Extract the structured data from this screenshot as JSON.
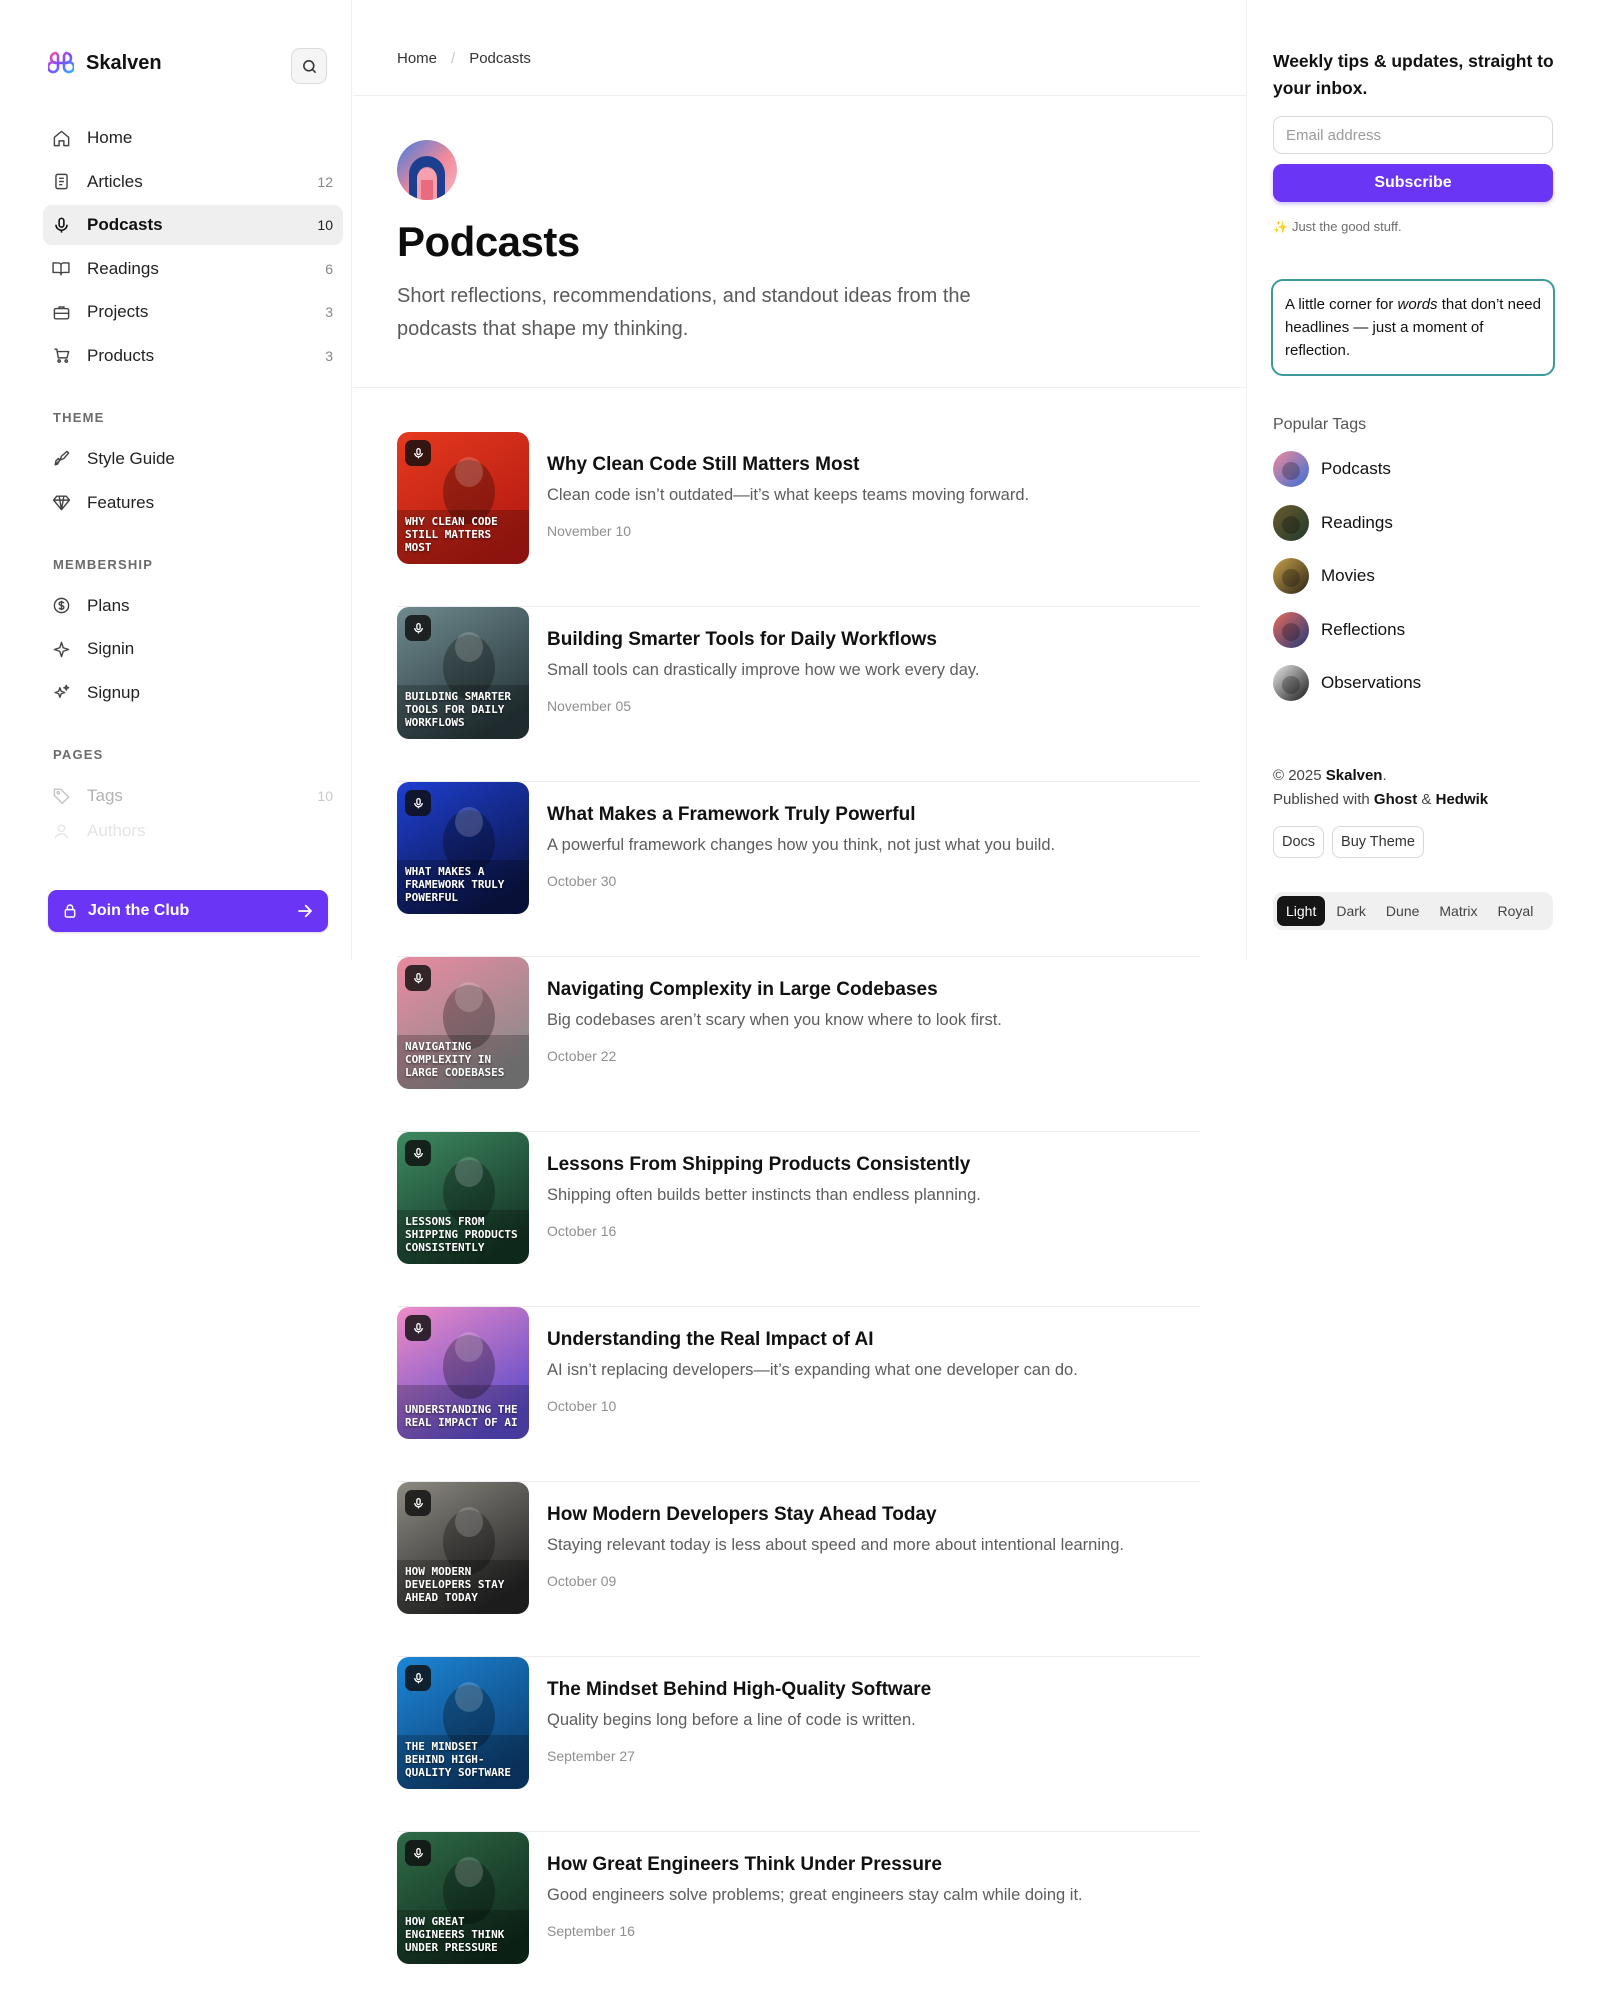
{
  "brand": {
    "name": "Skalven"
  },
  "nav": {
    "main": [
      {
        "label": "Home",
        "count": "",
        "icon": "home-icon"
      },
      {
        "label": "Articles",
        "count": "12",
        "icon": "document-icon"
      },
      {
        "label": "Podcasts",
        "count": "10",
        "icon": "microphone-icon",
        "active": true
      },
      {
        "label": "Readings",
        "count": "6",
        "icon": "book-icon"
      },
      {
        "label": "Projects",
        "count": "3",
        "icon": "briefcase-icon"
      },
      {
        "label": "Products",
        "count": "3",
        "icon": "cart-icon"
      }
    ],
    "theme_title": "THEME",
    "theme": [
      {
        "label": "Style Guide",
        "icon": "palette-icon"
      },
      {
        "label": "Features",
        "icon": "diamond-icon"
      }
    ],
    "membership_title": "MEMBERSHIP",
    "membership": [
      {
        "label": "Plans",
        "icon": "dollar-icon"
      },
      {
        "label": "Signin",
        "icon": "sparkle-icon"
      },
      {
        "label": "Signup",
        "icon": "sparkles-icon"
      }
    ],
    "pages_title": "PAGES",
    "pages": [
      {
        "label": "Tags",
        "count": "10",
        "icon": "tag-icon"
      },
      {
        "label": "Authors",
        "count": "",
        "icon": "user-icon"
      }
    ],
    "join_label": "Join the Club"
  },
  "breadcrumb": {
    "home": "Home",
    "current": "Podcasts"
  },
  "page": {
    "title": "Podcasts",
    "description": "Short reflections, recommendations, and standout ideas from the podcasts that shape my thinking."
  },
  "posts": [
    {
      "title": "Why Clean Code Still Matters Most",
      "excerpt": "Clean code isn’t outdated—it’s what keeps teams moving forward.",
      "date": "November 10",
      "thumb_text": "WHY CLEAN CODE STILL MATTERS MOST",
      "colors": [
        "#e53a1e",
        "#b51a12"
      ]
    },
    {
      "title": "Building Smarter Tools for Daily Workflows",
      "excerpt": "Small tools can drastically improve how we work every day.",
      "date": "November 05",
      "thumb_text": "BUILDING SMARTER TOOLS FOR DAILY WORKFLOWS",
      "colors": [
        "#6f8a8e",
        "#27373b"
      ]
    },
    {
      "title": "What Makes a Framework Truly Powerful",
      "excerpt": "A powerful framework changes how you think, not just what you build.",
      "date": "October 30",
      "thumb_text": "WHAT MAKES A FRAMEWORK TRULY POWERFUL",
      "colors": [
        "#1e3fd1",
        "#0b1548"
      ]
    },
    {
      "title": "Navigating Complexity in Large Codebases",
      "excerpt": "Big codebases aren’t scary when you know where to look first.",
      "date": "October 22",
      "thumb_text": "NAVIGATING COMPLEXITY IN LARGE CODEBASES",
      "colors": [
        "#e98aa0",
        "#8a8a8a"
      ]
    },
    {
      "title": "Lessons From Shipping Products Consistently",
      "excerpt": "Shipping often builds better instincts than endless planning.",
      "date": "October 16",
      "thumb_text": "LESSONS FROM SHIPPING PRODUCTS CONSISTENTLY",
      "colors": [
        "#3d8a62",
        "#143424"
      ]
    },
    {
      "title": "Understanding the Real Impact of AI",
      "excerpt": "AI isn’t replacing developers—it’s expanding what one developer can do.",
      "date": "October 10",
      "thumb_text": "UNDERSTANDING THE REAL IMPACT OF AI",
      "colors": [
        "#f08cc9",
        "#5c4bc9"
      ]
    },
    {
      "title": "How Modern Developers Stay Ahead Today",
      "excerpt": "Staying relevant today is less about speed and more about intentional learning.",
      "date": "October 09",
      "thumb_text": "HOW MODERN DEVELOPERS STAY AHEAD TODAY",
      "colors": [
        "#8d8a82",
        "#242424"
      ]
    },
    {
      "title": "The Mindset Behind High-Quality Software",
      "excerpt": "Quality begins long before a line of code is written.",
      "date": "September 27",
      "thumb_text": "THE MINDSET BEHIND HIGH-QUALITY SOFTWARE",
      "colors": [
        "#1c86d6",
        "#0d3f73"
      ]
    },
    {
      "title": "How Great Engineers Think Under Pressure",
      "excerpt": "Good engineers solve problems; great engineers stay calm while doing it.",
      "date": "September 16",
      "thumb_text": "HOW GREAT ENGINEERS THINK UNDER PRESSURE",
      "colors": [
        "#2f6b48",
        "#0f2a1b"
      ]
    }
  ],
  "aside": {
    "newsletter_title": "Weekly tips & updates, straight to your inbox.",
    "email_placeholder": "Email address",
    "subscribe_label": "Subscribe",
    "note": "Just the good stuff.",
    "quote_pre": "A little corner for ",
    "quote_em": "words",
    "quote_post": " that don’t need headlines — just a moment of reflection.",
    "tags_title": "Popular Tags",
    "tags": [
      {
        "label": "Podcasts",
        "colors": [
          "#f08a9a",
          "#3a6fd8"
        ]
      },
      {
        "label": "Readings",
        "colors": [
          "#6b5a2e",
          "#1f3a2a"
        ]
      },
      {
        "label": "Movies",
        "colors": [
          "#c9a24a",
          "#2a2418"
        ]
      },
      {
        "label": "Reflections",
        "colors": [
          "#e96b5b",
          "#233a7a"
        ]
      },
      {
        "label": "Observations",
        "colors": [
          "#e9e9e9",
          "#1a1a1a"
        ]
      }
    ],
    "copyright_line": "© 2025",
    "copyright_brand": "Skalven",
    "published_prefix": "Published with",
    "published_ghost": "Ghost",
    "published_and": "&",
    "published_hedwik": "Hedwik",
    "links": [
      "Docs",
      "Buy Theme"
    ],
    "theme_options": [
      "Light",
      "Dark",
      "Dune",
      "Matrix",
      "Royal"
    ],
    "theme_active": "Light"
  },
  "colors": {
    "accent": "#6b35f6",
    "quote_border": "#3d9a9a"
  }
}
